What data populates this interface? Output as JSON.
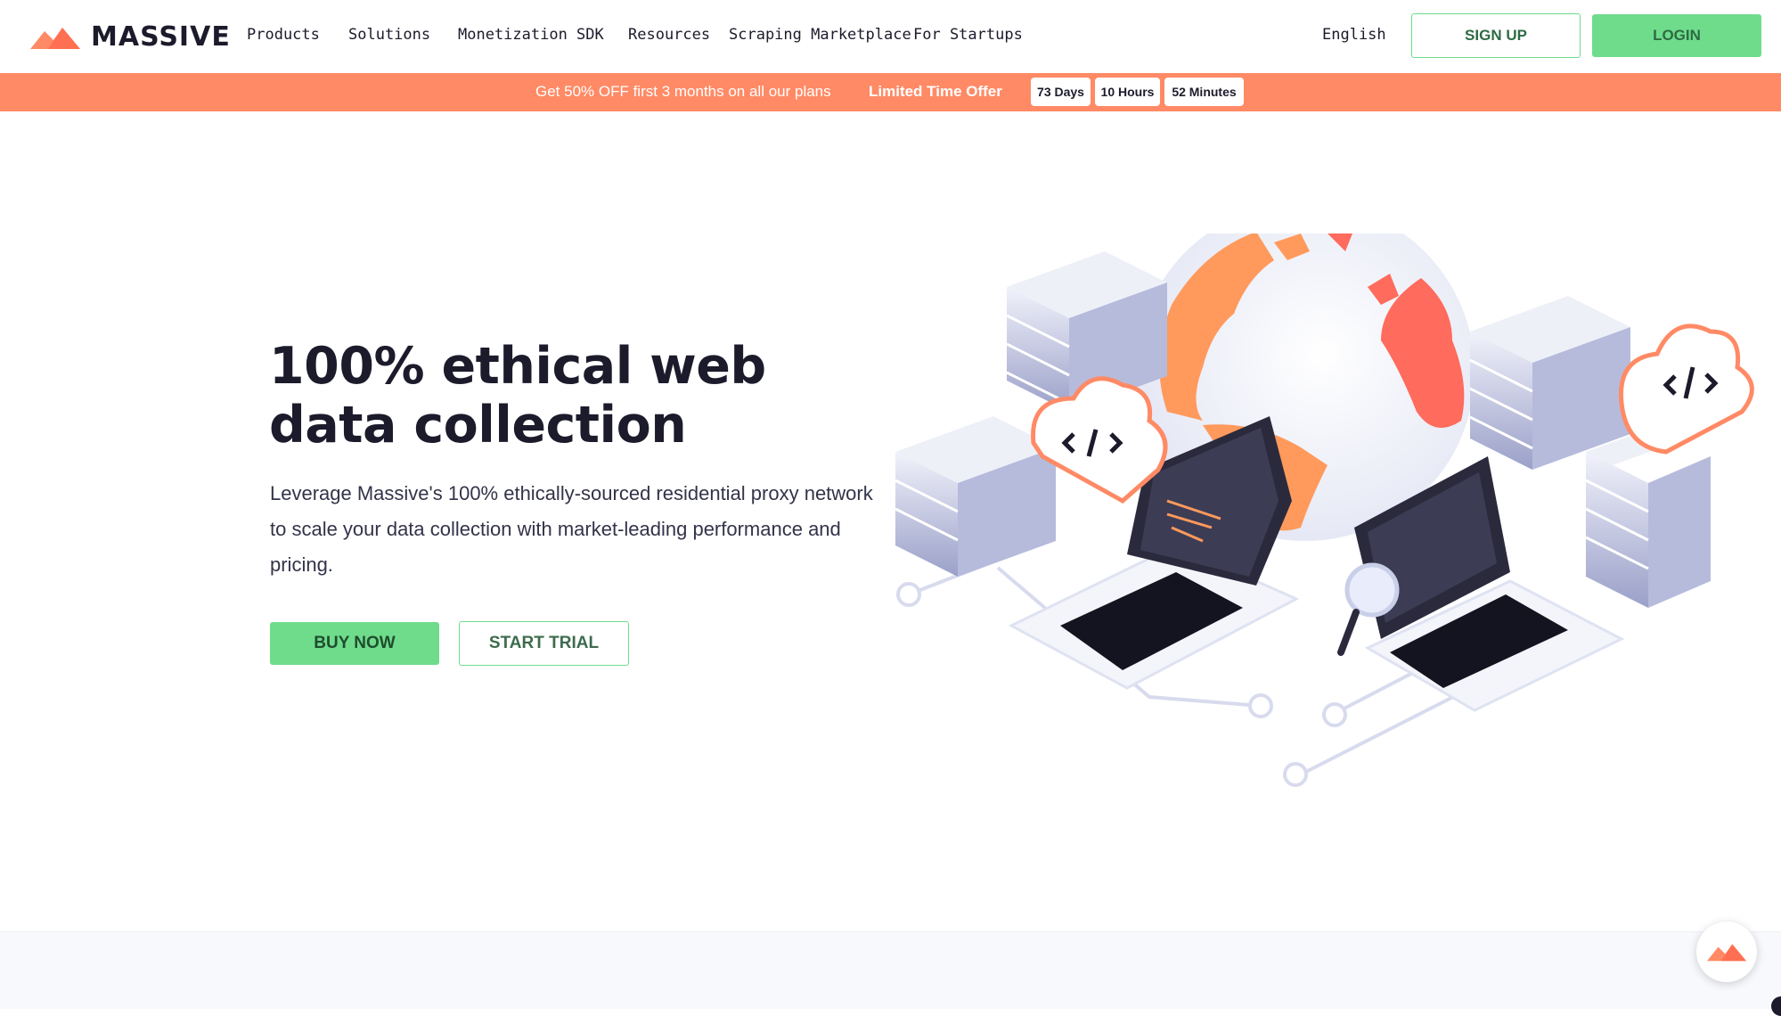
{
  "brand": {
    "name": "MASSIVE",
    "logo_icon": "mountain-logo-icon",
    "accent": "#ff8a65",
    "green": "#6fdc8c"
  },
  "nav": {
    "items": [
      {
        "label": "Products"
      },
      {
        "label": "Solutions"
      },
      {
        "label": "Monetization SDK"
      },
      {
        "label": "Resources"
      },
      {
        "label": "Scraping Marketplace"
      },
      {
        "label": "For Startups"
      }
    ],
    "language": "English",
    "signup_label": "SIGN UP",
    "login_label": "LOGIN"
  },
  "promo": {
    "text": "Get 50% OFF first 3 months on all our plans",
    "offer": "Limited Time Offer",
    "countdown": {
      "days": "73 Days",
      "hours": "10 Hours",
      "minutes": "52 Minutes"
    }
  },
  "hero": {
    "title_line1": "100% ethical web",
    "title_line2": "data collection",
    "description": "Leverage Massive's 100% ethically-sourced residential proxy network to scale your data collection with market-leading performance and pricing.",
    "buy_label": "BUY NOW",
    "trial_label": "START TRIAL",
    "illustration_icon": "servers-laptops-globe-illustration"
  },
  "chat_widget": {
    "icon": "mountain-logo-icon"
  }
}
